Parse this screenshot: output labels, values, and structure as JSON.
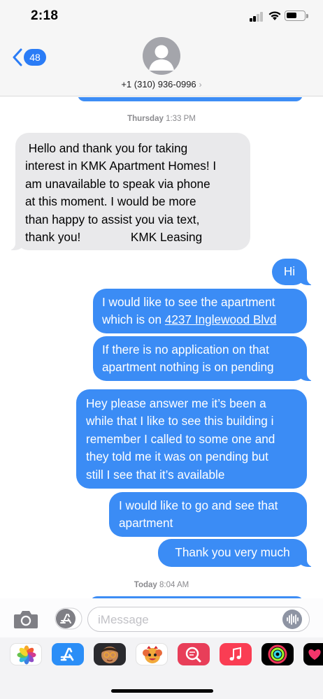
{
  "status_bar": {
    "time": "2:18"
  },
  "header": {
    "back_count": "48",
    "contact": "+1 (310) 936-0996",
    "chevron": "›"
  },
  "thread": {
    "timestamp1": {
      "day": "Thursday",
      "time": "1:33 PM"
    },
    "incoming": {
      "text": " Hello and thank you for taking\ninterest in KMK Apartment Homes! I\nam unavailable to speak via phone\nat this moment. I would be more\nthan happy to assist you via text,\nthank you!               KMK Leasing"
    },
    "outgoing": [
      {
        "text": "Hi"
      },
      {
        "text_before": "I would like to see the apartment\nwhich is on ",
        "link": "4237 Inglewood Blvd"
      },
      {
        "text": "If there is no application on that\napartment nothing is on pending"
      },
      {
        "text": "Hey please answer me it’s been a\nwhile that I like to see this building i\nremember I called to some one and\nthey told me it was on pending but\nstill I see that it’s available"
      },
      {
        "text": "I would like to go and see that\napartment"
      },
      {
        "text": "Thank you very much"
      }
    ],
    "timestamp2": {
      "day": "Today",
      "time": "8:04 AM"
    }
  },
  "input": {
    "placeholder": "iMessage"
  },
  "app_drawer": {
    "apps": [
      "photos-icon",
      "app-store-icon",
      "memoji-icon",
      "animoji-icon",
      "image-search-icon",
      "music-icon",
      "fitness-icon",
      "digital-touch-icon"
    ]
  },
  "colors": {
    "accent": "#3b8cf5",
    "incoming_bubble": "#e9e9eb",
    "badge": "#2a7cf6"
  }
}
